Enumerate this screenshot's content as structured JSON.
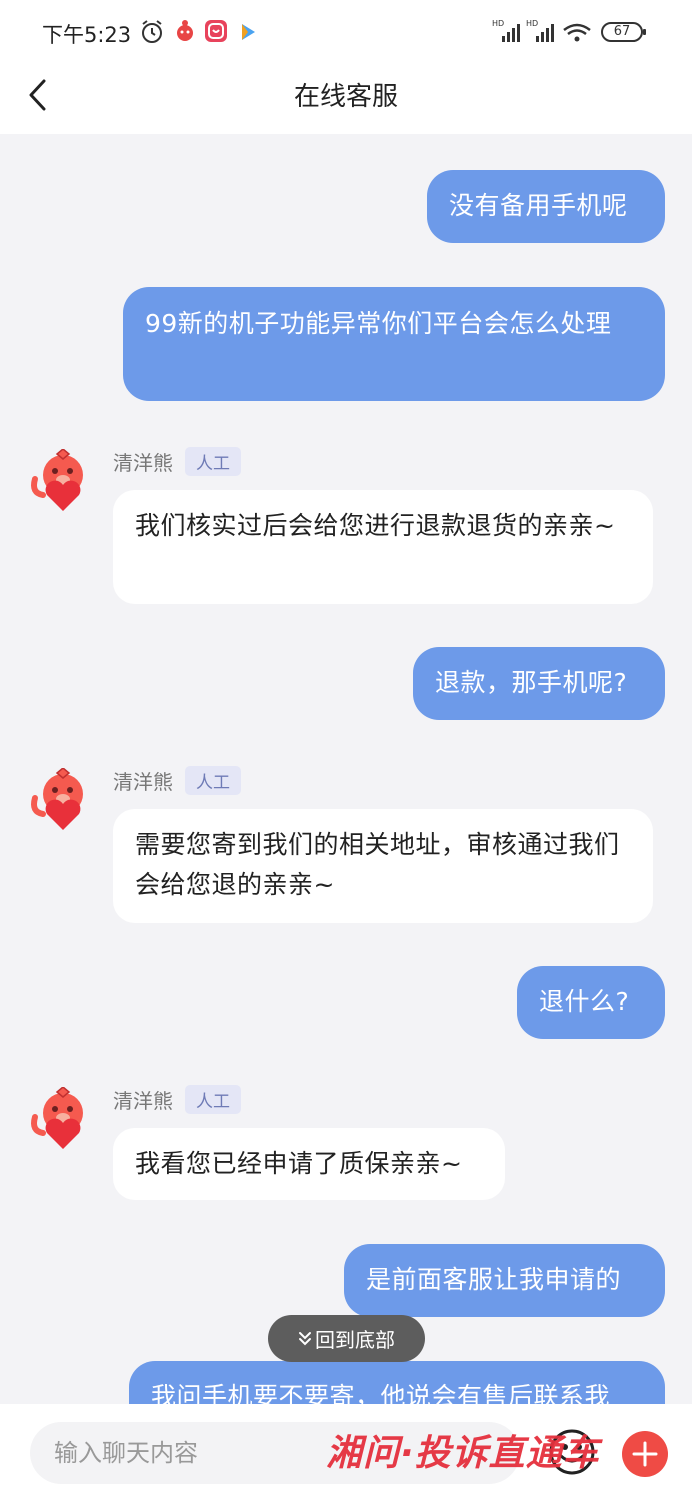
{
  "status_bar": {
    "time": "下午5:23",
    "battery": "67",
    "signal_label": "HD"
  },
  "header": {
    "title": "在线客服"
  },
  "messages": [
    {
      "from": "user",
      "text": "没有备用手机呢"
    },
    {
      "from": "user",
      "text": "99新的机子功能异常你们平台会怎么处理"
    },
    {
      "from": "agent",
      "sender": "清洋熊",
      "badge": "人工",
      "text": "我们核实过后会给您进行退款退货的亲亲~"
    },
    {
      "from": "user",
      "text": "退款，那手机呢?"
    },
    {
      "from": "agent",
      "sender": "清洋熊",
      "badge": "人工",
      "text": "需要您寄到我们的相关地址，审核通过我们会给您退的亲亲~"
    },
    {
      "from": "user",
      "text": "退什么?"
    },
    {
      "from": "agent",
      "sender": "清洋熊",
      "badge": "人工",
      "text": "我看您已经申请了质保亲亲~"
    },
    {
      "from": "user",
      "text": "是前面客服让我申请的"
    },
    {
      "from": "user",
      "text": "我问手机要不要寄，他说会有售后联系我"
    }
  ],
  "scroll_to_bottom": {
    "label": "回到底部"
  },
  "input": {
    "placeholder": "输入聊天内容"
  },
  "watermark": "湘问·投诉直通车",
  "icons": {
    "back": "chevron-left-icon",
    "emoji": "smiley-icon",
    "plus": "plus-icon"
  },
  "colors": {
    "user_bubble": "#6d9ae9",
    "agent_bubble": "#ffffff",
    "background": "#f3f3f6",
    "plus_button": "#ef4b45",
    "watermark": "#e5303d"
  }
}
